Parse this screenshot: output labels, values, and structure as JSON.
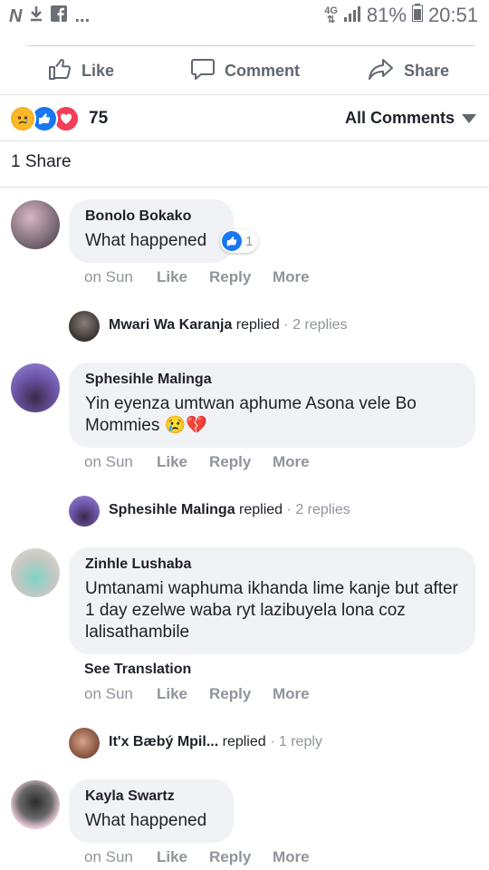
{
  "status_bar": {
    "left_icons": [
      "n-icon",
      "download-icon",
      "facebook-icon"
    ],
    "ellipsis": "...",
    "network": "4G",
    "battery": "81%",
    "time": "20:51"
  },
  "actions": {
    "like": "Like",
    "comment": "Comment",
    "share": "Share"
  },
  "reactions": {
    "count": "75",
    "types": [
      "sad",
      "like",
      "love"
    ]
  },
  "filter": {
    "label": "All Comments"
  },
  "shares": {
    "label": "1 Share"
  },
  "comments": [
    {
      "name": "Bonolo Bokako",
      "text": "What happened",
      "time": "on Sun",
      "like": "Like",
      "reply": "Reply",
      "more": "More",
      "reaction_count": "1",
      "reply_preview": {
        "name": "Mwari Wa Karanja",
        "replied": "replied",
        "sep": "·",
        "count": "2 replies"
      }
    },
    {
      "name": "Sphesihle Malinga",
      "text": "Yin eyenza umtwan aphume Asona vele Bo Mommies 😢💔",
      "time": "on Sun",
      "like": "Like",
      "reply": "Reply",
      "more": "More",
      "reply_preview": {
        "name": "Sphesihle Malinga",
        "replied": "replied",
        "sep": "·",
        "count": "2 replies"
      }
    },
    {
      "name": "Zinhle Lushaba",
      "text": "Umtanami waphuma ikhanda lime kanje but after 1 day ezelwe waba ryt lazibuyela lona coz lalisathambile",
      "see_translation": "See Translation",
      "time": "on Sun",
      "like": "Like",
      "reply": "Reply",
      "more": "More",
      "reply_preview": {
        "name": "It'x Bæbý Mpil...",
        "replied": "replied",
        "sep": "·",
        "count": "1 reply"
      }
    },
    {
      "name": "Kayla Swartz",
      "text": "What happened",
      "time": "on Sun",
      "like": "Like",
      "reply": "Reply",
      "more": "More"
    }
  ]
}
